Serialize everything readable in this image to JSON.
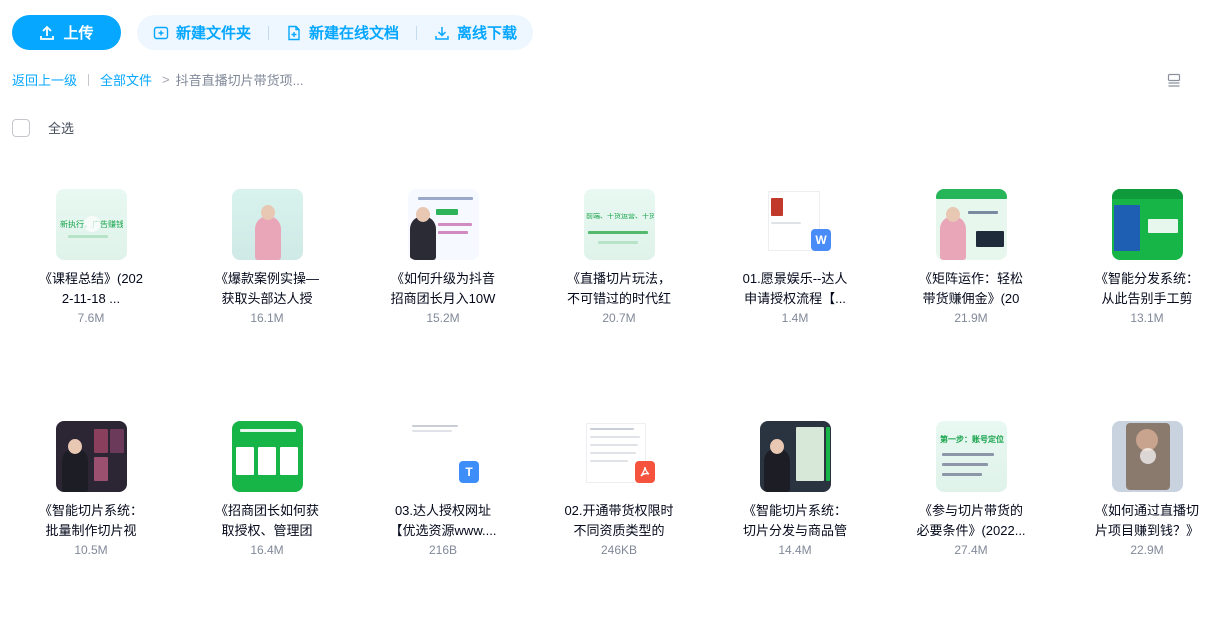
{
  "toolbar": {
    "upload_label": "上传",
    "new_folder_label": "新建文件夹",
    "new_online_doc_label": "新建在线文档",
    "offline_download_label": "离线下载"
  },
  "breadcrumb": {
    "back_label": "返回上一级",
    "all_files_label": "全部文件",
    "current_label": "抖音直播切片带货项..."
  },
  "select_all_label": "全选",
  "files": [
    {
      "name_line1": "《课程总结》(202",
      "name_line2": "2-11-18 ...",
      "size": "7.6M"
    },
    {
      "name_line1": "《爆款案例实操—",
      "name_line2": "获取头部达人授",
      "size": "16.1M"
    },
    {
      "name_line1": "《如何升级为抖音",
      "name_line2": "招商团长月入10W",
      "size": "15.2M"
    },
    {
      "name_line1": "《直播切片玩法，",
      "name_line2": "不可错过的时代红",
      "size": "20.7M"
    },
    {
      "name_line1": "01.愿景娱乐--达人",
      "name_line2": "申请授权流程【...",
      "size": "1.4M"
    },
    {
      "name_line1": "《矩阵运作：轻松",
      "name_line2": "带货赚佣金》(20",
      "size": "21.9M"
    },
    {
      "name_line1": "《智能分发系统：",
      "name_line2": "从此告别手工剪",
      "size": "13.1M"
    },
    {
      "name_line1": "《智能切片系统：",
      "name_line2": "批量制作切片视",
      "size": "10.5M"
    },
    {
      "name_line1": "《招商团长如何获",
      "name_line2": "取授权、管理团",
      "size": "16.4M"
    },
    {
      "name_line1": "03.达人授权网址",
      "name_line2": "【优选资源www....",
      "size": "216B"
    },
    {
      "name_line1": "02.开通带货权限时",
      "name_line2": "不同资质类型的",
      "size": "246KB"
    },
    {
      "name_line1": "《智能切片系统：",
      "name_line2": "切片分发与商品管",
      "size": "14.4M"
    },
    {
      "name_line1": "《参与切片带货的",
      "name_line2": "必要条件》(2022...",
      "size": "27.4M"
    },
    {
      "name_line1": "《如何通过直播切",
      "name_line2": "片项目赚到钱？》",
      "size": "22.9M"
    }
  ],
  "thumb_text": {
    "t1": "新执行，广告赚钱的可",
    "t4": "前端、干货运营、干货主播、干",
    "t13": "第一步：账号定位"
  },
  "badges": {
    "word": "W",
    "text": "T"
  },
  "colors": {
    "accent": "#06a7ff",
    "word_badge": "#4a8cf7",
    "text_badge": "#3d8ef8",
    "pdf_badge": "#f5533d"
  },
  "icons": [
    "upload-icon",
    "new-folder-icon",
    "new-doc-icon",
    "download-icon",
    "list-view-icon"
  ]
}
